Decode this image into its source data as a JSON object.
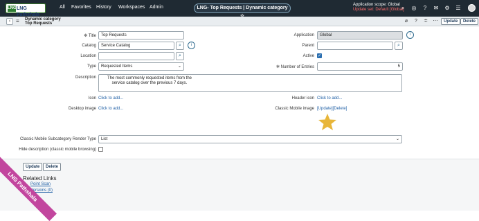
{
  "topbar": {
    "logo_text": "LNG Pathshala",
    "logo_abbrev": "LNG",
    "nav": [
      "All",
      "Favorites",
      "History",
      "Workspaces",
      "Admin"
    ],
    "record_pill": "LNG- Top Requests | Dynamic category ☆",
    "scope_label": "Application scope: Global",
    "update_set": "Update set: Default [Global]",
    "icons": [
      "search-icon",
      "globe-icon",
      "help-icon",
      "notifications-icon",
      "settings-icon",
      "chat-icon"
    ]
  },
  "header": {
    "title_line1": "Dynamic category",
    "title_line2": "Top Requests",
    "update_btn": "Update",
    "delete_btn": "Delete"
  },
  "form": {
    "title_label": "Title",
    "title_value": "Top Requests",
    "catalog_label": "Catalog",
    "catalog_value": "Service Catalog",
    "location_label": "Location",
    "location_value": "",
    "type_label": "Type",
    "type_value": "Requested Items",
    "description_label": "Description",
    "description_value": "The most commonly requested items from the service catalog over the previous 7 days.",
    "icon_label": "Icon",
    "icon_link": "Click to add...",
    "desktop_image_label": "Desktop image",
    "desktop_image_link": "Click to add...",
    "application_label": "Application",
    "application_value": "Global",
    "parent_label": "Parent",
    "parent_value": "",
    "active_label": "Active",
    "active_checked": true,
    "entries_label": "Number of Entries",
    "entries_value": "5",
    "header_icon_label": "Header icon",
    "header_icon_link": "Click to add...",
    "mobile_image_label": "Classic Mobile image",
    "mobile_image_link": "[Update][Delete]",
    "render_type_label": "Classic Mobile Subcategory Render Type",
    "render_type_value": "List",
    "hide_desc_label": "Hide description (classic mobile browsing)",
    "hide_desc_checked": false
  },
  "footer": {
    "update_btn": "Update",
    "delete_btn": "Delete",
    "related_title": "Related Links",
    "related_links": [
      "Point Scan",
      "Versions (0)"
    ]
  },
  "watermark": "LNG Pathshala",
  "colors": {
    "topbar": "#1f2a33",
    "accent": "#2f6b8f",
    "update_set": "#ff6b6b",
    "star": "#e8b63a",
    "watermark": "#c2469e"
  }
}
